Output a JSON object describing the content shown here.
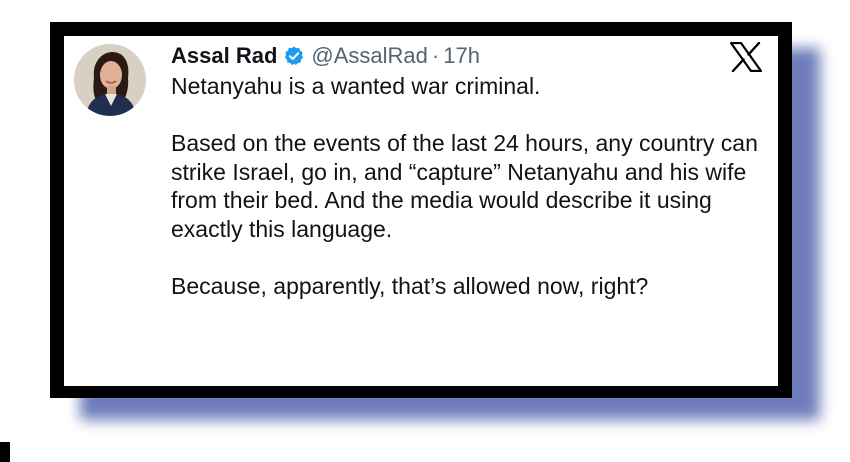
{
  "tweet": {
    "author": {
      "name": "Assal Rad",
      "handle": "@AssalRad",
      "separator": "·",
      "time": "17h",
      "verified_icon": "verified-badge-icon",
      "avatar": "profile-photo"
    },
    "platform_icon": "x-logo-icon",
    "paragraphs": [
      "Netanyahu is a wanted war criminal.",
      "Based on the events of the last 24 hours, any country can strike Israel, go in, and “capture” Netanyahu and his wife from their bed. And the media would describe it using exactly this language.",
      "Because, apparently, that’s allowed now, right?"
    ]
  },
  "colors": {
    "frame": "#000000",
    "shadow": "#5566b0",
    "verified_blue": "#1d9bf0",
    "text_primary": "#0f1419",
    "text_secondary": "#536471"
  }
}
